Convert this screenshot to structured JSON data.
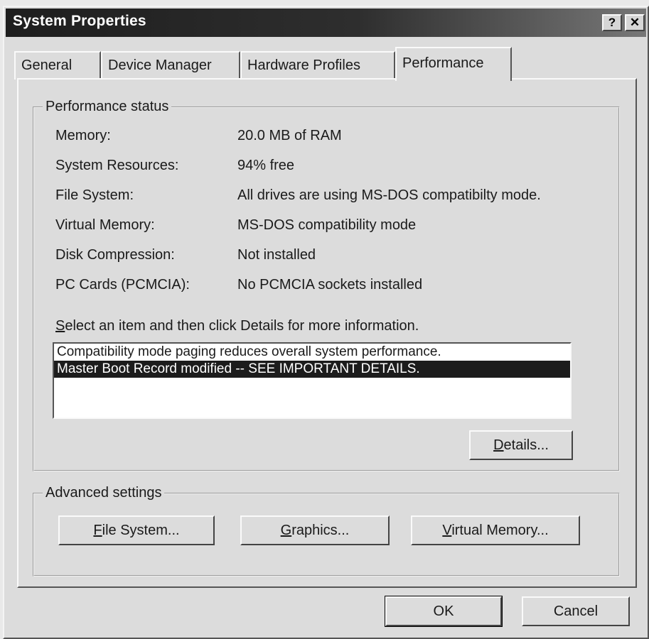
{
  "window": {
    "title": "System Properties",
    "help_glyph": "?",
    "close_glyph": "✕"
  },
  "tabs": [
    {
      "label": "General"
    },
    {
      "label": "Device Manager"
    },
    {
      "label": "Hardware Profiles"
    },
    {
      "label": "Performance",
      "active": true
    }
  ],
  "performance_status": {
    "title": "Performance status",
    "rows": [
      {
        "label": "Memory:",
        "value": "20.0 MB of RAM"
      },
      {
        "label": "System Resources:",
        "value": "94% free"
      },
      {
        "label": "File System:",
        "value": "All drives are using MS-DOS compatibilty mode."
      },
      {
        "label": "Virtual Memory:",
        "value": "MS-DOS compatibility mode"
      },
      {
        "label": "Disk Compression:",
        "value": "Not installed"
      },
      {
        "label": "PC Cards (PCMCIA):",
        "value": "No PCMCIA sockets installed"
      }
    ],
    "instruction_key": "S",
    "instruction_rest": "elect an item and then click Details for more information.",
    "list_items": [
      {
        "text": "Compatibility mode paging reduces overall system performance.",
        "selected": false
      },
      {
        "text": "Master Boot Record modified -- SEE IMPORTANT DETAILS.",
        "selected": true
      }
    ],
    "details_key": "D",
    "details_rest": "etails..."
  },
  "advanced_settings": {
    "title": "Advanced settings",
    "file_system_key": "F",
    "file_system_rest": "ile System...",
    "graphics_key": "G",
    "graphics_rest": "raphics...",
    "virtual_memory_key": "V",
    "virtual_memory_rest": "irtual Memory..."
  },
  "footer": {
    "ok_label": "OK",
    "cancel_label": "Cancel"
  }
}
